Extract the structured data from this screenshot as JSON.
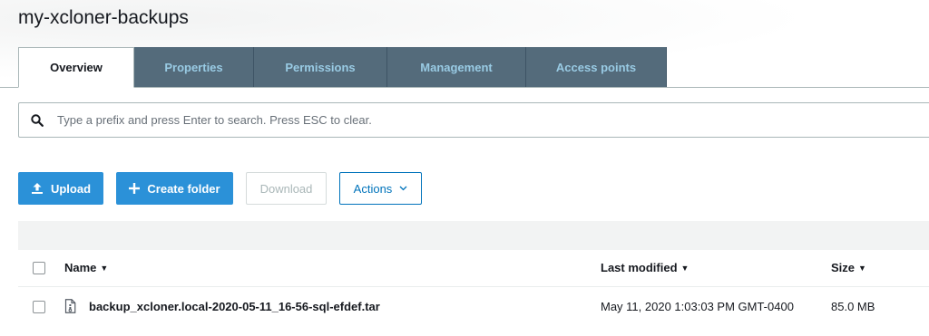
{
  "bucket": {
    "title": "my-xcloner-backups"
  },
  "tabs": [
    {
      "label": "Overview",
      "active": true
    },
    {
      "label": "Properties",
      "active": false
    },
    {
      "label": "Permissions",
      "active": false
    },
    {
      "label": "Management",
      "active": false
    },
    {
      "label": "Access points",
      "active": false
    }
  ],
  "search": {
    "placeholder": "Type a prefix and press Enter to search. Press ESC to clear.",
    "value": ""
  },
  "toolbar": {
    "upload_label": "Upload",
    "create_folder_label": "Create folder",
    "download_label": "Download",
    "actions_label": "Actions"
  },
  "table": {
    "columns": {
      "name": "Name",
      "last_modified": "Last modified",
      "size": "Size"
    },
    "rows": [
      {
        "name": "backup_xcloner.local-2020-05-11_16-56-sql-efdef.tar",
        "last_modified": "May 11, 2020 1:03:03 PM GMT-0400",
        "size": "85.0 MB"
      }
    ]
  },
  "colors": {
    "tab_bg": "#546b7b",
    "tab_text": "#99cbe4",
    "primary": "#2b91d8",
    "link": "#0073bb"
  }
}
